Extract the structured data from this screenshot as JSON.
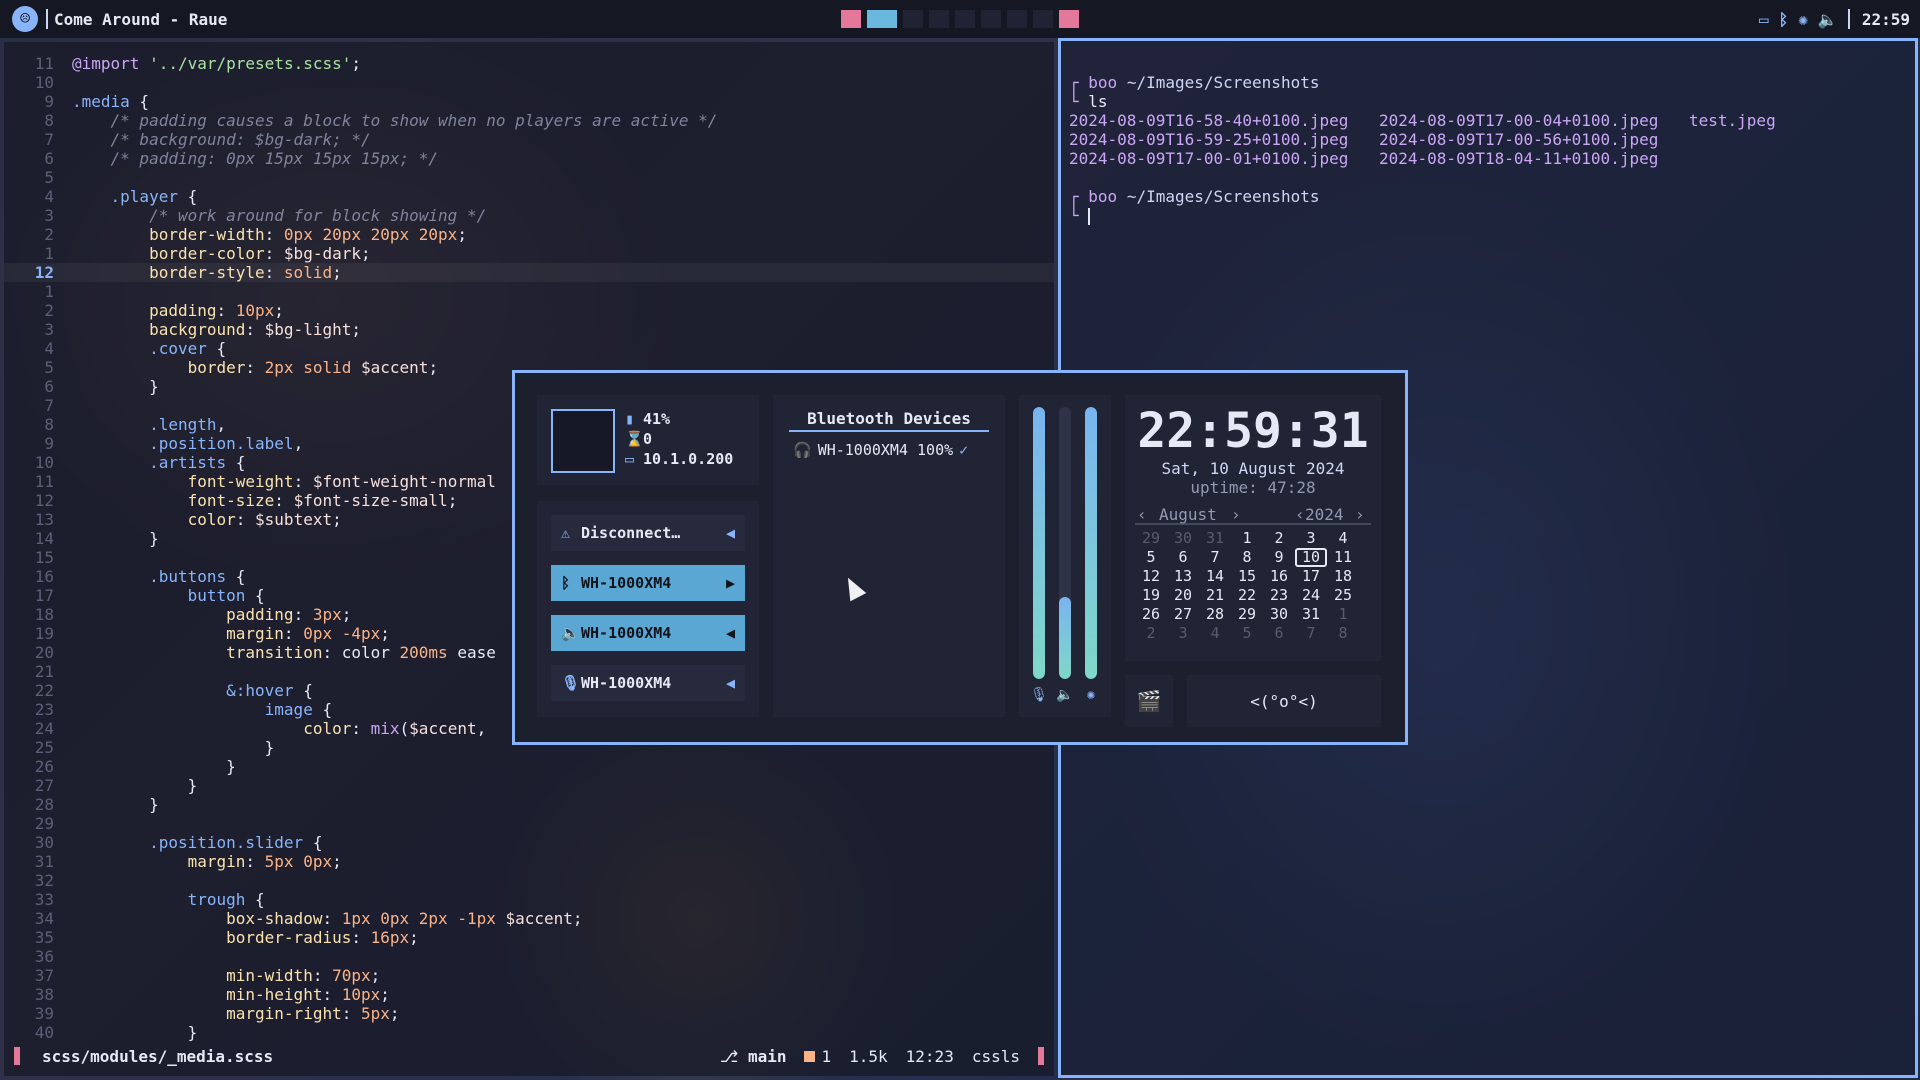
{
  "topbar": {
    "title": "Come Around - Raue",
    "clock": "22:59"
  },
  "editor": {
    "lines": [
      {
        "n": "11",
        "html": "<span class='c-kw'>@import</span> <span class='c-str'>'../var/presets.scss'</span>;"
      },
      {
        "n": "10",
        "html": ""
      },
      {
        "n": "9",
        "html": "<span class='c-sel'>.media</span> {"
      },
      {
        "n": "8",
        "html": "    <span class='c-com'>/* padding causes a block to show when no players are active */</span>"
      },
      {
        "n": "7",
        "html": "    <span class='c-com'>/* background: $bg-dark; */</span>"
      },
      {
        "n": "6",
        "html": "    <span class='c-com'>/* padding: 0px 15px 15px 15px; */</span>"
      },
      {
        "n": "5",
        "html": ""
      },
      {
        "n": "4",
        "html": "    <span class='c-sel'>.player</span> {"
      },
      {
        "n": "3",
        "html": "        <span class='c-com'>/* work around for block showing */</span>"
      },
      {
        "n": "2",
        "html": "        <span class='c-prop'>border-width</span>: <span class='c-num'>0px 20px 20px 20px</span>;"
      },
      {
        "n": "1",
        "html": "        <span class='c-prop'>border-color</span>: <span class='c-var'>$bg-dark</span>;"
      },
      {
        "n": "12",
        "cur": true,
        "html": "        <span class='c-prop'>border-style</span>: <span class='c-num'>solid</span>;"
      },
      {
        "n": "1",
        "html": ""
      },
      {
        "n": "2",
        "html": "        <span class='c-prop'>padding</span>: <span class='c-num'>10px</span>;"
      },
      {
        "n": "3",
        "html": "        <span class='c-prop'>background</span>: <span class='c-var'>$bg-light</span>;"
      },
      {
        "n": "4",
        "html": "        <span class='c-sel'>.cover</span> {"
      },
      {
        "n": "5",
        "html": "            <span class='c-prop'>border</span>: <span class='c-num'>2px solid</span> <span class='c-var'>$accent</span>;"
      },
      {
        "n": "6",
        "html": "        }"
      },
      {
        "n": "7",
        "html": ""
      },
      {
        "n": "8",
        "html": "        <span class='c-sel'>.length</span>,"
      },
      {
        "n": "9",
        "html": "        <span class='c-sel'>.position.label</span>,"
      },
      {
        "n": "10",
        "html": "        <span class='c-sel'>.artists</span> {"
      },
      {
        "n": "11",
        "html": "            <span class='c-prop'>font-weight</span>: <span class='c-var'>$font-weight-normal</span>"
      },
      {
        "n": "12",
        "html": "            <span class='c-prop'>font-size</span>: <span class='c-var'>$font-size-small</span>;"
      },
      {
        "n": "13",
        "html": "            <span class='c-prop'>color</span>: <span class='c-var'>$subtext</span>;"
      },
      {
        "n": "14",
        "html": "        }"
      },
      {
        "n": "15",
        "html": ""
      },
      {
        "n": "16",
        "html": "        <span class='c-sel'>.buttons</span> {"
      },
      {
        "n": "17",
        "html": "            <span class='c-sel'>button</span> {"
      },
      {
        "n": "18",
        "html": "                <span class='c-prop'>padding</span>: <span class='c-num'>3px</span>;"
      },
      {
        "n": "19",
        "html": "                <span class='c-prop'>margin</span>: <span class='c-num'>0px -4px</span>;"
      },
      {
        "n": "20",
        "html": "                <span class='c-prop'>transition</span>: color <span class='c-num'>200ms</span> ease"
      },
      {
        "n": "21",
        "html": ""
      },
      {
        "n": "22",
        "html": "                <span class='c-sel'>&amp;:hover</span> {"
      },
      {
        "n": "23",
        "html": "                    <span class='c-sel'>image</span> {"
      },
      {
        "n": "24",
        "html": "                        <span class='c-prop'>color</span>: <span class='c-kw'>mix</span>(<span class='c-var'>$accent</span>,"
      },
      {
        "n": "25",
        "html": "                    }"
      },
      {
        "n": "26",
        "html": "                }"
      },
      {
        "n": "27",
        "html": "            }"
      },
      {
        "n": "28",
        "html": "        }"
      },
      {
        "n": "29",
        "html": ""
      },
      {
        "n": "30",
        "html": "        <span class='c-sel'>.position.slider</span> {"
      },
      {
        "n": "31",
        "html": "            <span class='c-prop'>margin</span>: <span class='c-num'>5px 0px</span>;"
      },
      {
        "n": "32",
        "html": ""
      },
      {
        "n": "33",
        "html": "            <span class='c-sel'>trough</span> {"
      },
      {
        "n": "34",
        "html": "                <span class='c-prop'>box-shadow</span>: <span class='c-num'>1px 0px 2px -1px</span> <span class='c-var'>$accent</span>;"
      },
      {
        "n": "35",
        "html": "                <span class='c-prop'>border-radius</span>: <span class='c-num'>16px</span>;"
      },
      {
        "n": "36",
        "html": ""
      },
      {
        "n": "37",
        "html": "                <span class='c-prop'>min-width</span>: <span class='c-num'>70px</span>;"
      },
      {
        "n": "38",
        "html": "                <span class='c-prop'>min-height</span>: <span class='c-num'>10px</span>;"
      },
      {
        "n": "39",
        "html": "                <span class='c-prop'>margin-right</span>: <span class='c-num'>5px</span>;"
      },
      {
        "n": "40",
        "html": "            }"
      }
    ],
    "status": {
      "file": "scss/modules/_media.scss",
      "branch": "main",
      "changes": "1",
      "size": "1.5k",
      "pos": "12:23",
      "lsp": "cssls"
    }
  },
  "terminal": {
    "prompt1_user": "boo",
    "prompt1_dir": "~/Images/Screenshots",
    "cmd": "ls",
    "files": [
      "2024-08-09T16-58-40+0100.jpeg",
      "2024-08-09T17-00-04+0100.jpeg",
      "test.jpeg",
      "2024-08-09T16-59-25+0100.jpeg",
      "2024-08-09T17-00-56+0100.jpeg",
      "",
      "2024-08-09T17-00-01+0100.jpeg",
      "2024-08-09T18-04-11+0100.jpeg",
      ""
    ],
    "prompt2_user": "boo",
    "prompt2_dir": "~/Images/Screenshots"
  },
  "popup": {
    "sys": {
      "battery": "41%",
      "tasks": "0",
      "ip": "10.1.0.200"
    },
    "devices": [
      {
        "icon": "wifi-off-icon",
        "glyph": "⚠",
        "label": "Disconnect…",
        "arrow": "◀",
        "on": false
      },
      {
        "icon": "bluetooth-icon",
        "glyph": "ᛒ",
        "label": "WH-1000XM4",
        "arrow": "▶",
        "on": true
      },
      {
        "icon": "speaker-icon",
        "glyph": "🔈",
        "label": "WH-1000XM4",
        "arrow": "◀",
        "on": true
      },
      {
        "icon": "mic-muted-icon",
        "glyph": "🎙",
        "label": "WH-1000XM4",
        "arrow": "◀",
        "on": false
      }
    ],
    "bt": {
      "title": "Bluetooth Devices",
      "device": "WH-1000XM4 100%"
    },
    "sliders": {
      "mic": 1.0,
      "volume": 0.3,
      "brightness": 1.0
    },
    "clock": {
      "time": "22:59:31",
      "date": "Sat, 10 August 2024",
      "uptime": "uptime: 47:28",
      "month": "August",
      "year": "2024",
      "days": [
        {
          "d": "29",
          "dim": true
        },
        {
          "d": "30",
          "dim": true
        },
        {
          "d": "31",
          "dim": true
        },
        {
          "d": "1"
        },
        {
          "d": "2"
        },
        {
          "d": "3"
        },
        {
          "d": "4"
        },
        {
          "d": "5"
        },
        {
          "d": "6"
        },
        {
          "d": "7"
        },
        {
          "d": "8"
        },
        {
          "d": "9"
        },
        {
          "d": "10",
          "today": true
        },
        {
          "d": "11"
        },
        {
          "d": "12"
        },
        {
          "d": "13"
        },
        {
          "d": "14"
        },
        {
          "d": "15"
        },
        {
          "d": "16"
        },
        {
          "d": "17"
        },
        {
          "d": "18"
        },
        {
          "d": "19"
        },
        {
          "d": "20"
        },
        {
          "d": "21"
        },
        {
          "d": "22"
        },
        {
          "d": "23"
        },
        {
          "d": "24"
        },
        {
          "d": "25"
        },
        {
          "d": "26"
        },
        {
          "d": "27"
        },
        {
          "d": "28"
        },
        {
          "d": "29"
        },
        {
          "d": "30"
        },
        {
          "d": "31"
        },
        {
          "d": "1",
          "dim": true
        },
        {
          "d": "2",
          "dim": true
        },
        {
          "d": "3",
          "dim": true
        },
        {
          "d": "4",
          "dim": true
        },
        {
          "d": "5",
          "dim": true
        },
        {
          "d": "6",
          "dim": true
        },
        {
          "d": "7",
          "dim": true
        },
        {
          "d": "8",
          "dim": true
        }
      ]
    },
    "face": "<(°o°<)"
  }
}
